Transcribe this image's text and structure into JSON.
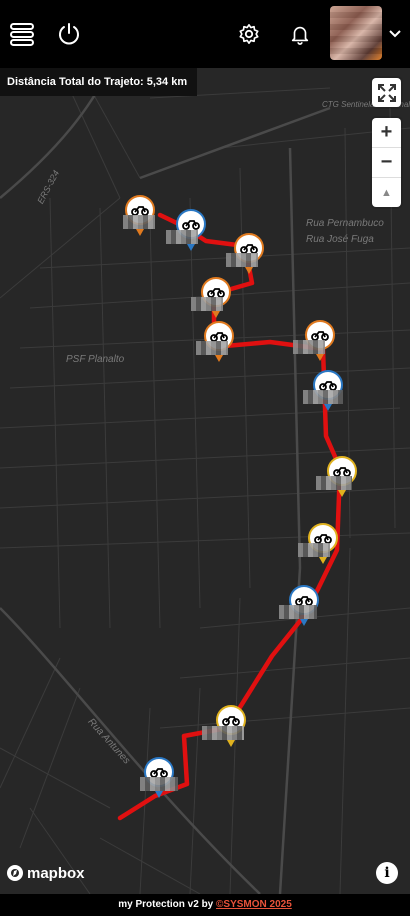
{
  "header": {
    "menu_icon": "menu-icon",
    "power_icon": "power-icon",
    "settings_icon": "gear-icon",
    "bell_icon": "bell-icon",
    "dropdown_icon": "chevron-down-icon"
  },
  "map": {
    "distance_label": "Distância Total do Trajeto: 5,34 km",
    "labels": [
      "ERS-324",
      "CTG Sentinela do Planalto",
      "Rua Pernambuco",
      "Rua José Fuga",
      "PSF Planalto",
      "Rua Antunes"
    ],
    "zoom_in": "+",
    "zoom_out": "−",
    "compass": "▲",
    "attribution_logo": "mapbox",
    "info": "i",
    "route_color": "#e01010",
    "pin_colors": {
      "orange": "#e07a1f",
      "blue": "#2a78c4",
      "yellow": "#e0b21f"
    }
  },
  "footer": {
    "text": "my Protection v2 by ",
    "link": "©SYSMON 2025"
  }
}
